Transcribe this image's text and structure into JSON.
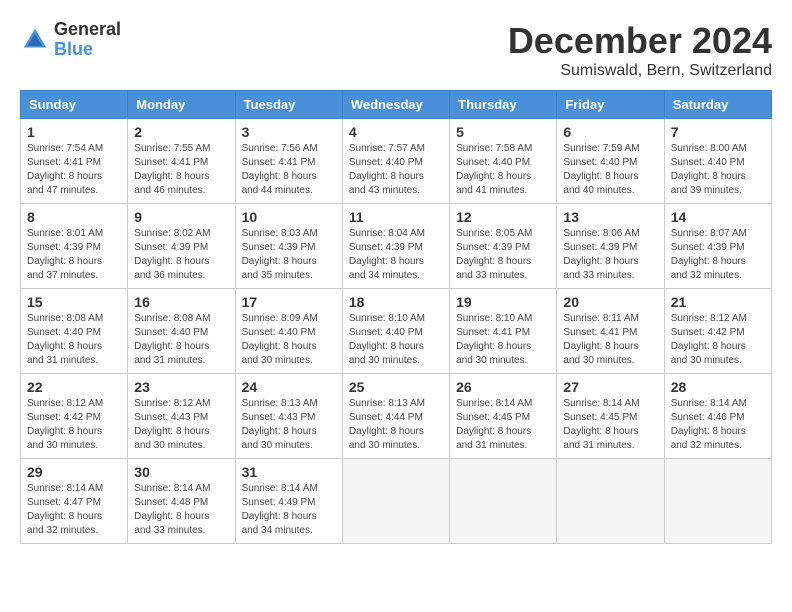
{
  "logo": {
    "general": "General",
    "blue": "Blue"
  },
  "title": "December 2024",
  "location": "Sumiswald, Bern, Switzerland",
  "headers": [
    "Sunday",
    "Monday",
    "Tuesday",
    "Wednesday",
    "Thursday",
    "Friday",
    "Saturday"
  ],
  "weeks": [
    [
      {
        "day": "1",
        "sunrise": "7:54 AM",
        "sunset": "4:41 PM",
        "daylight": "8 hours and 47 minutes."
      },
      {
        "day": "2",
        "sunrise": "7:55 AM",
        "sunset": "4:41 PM",
        "daylight": "8 hours and 46 minutes."
      },
      {
        "day": "3",
        "sunrise": "7:56 AM",
        "sunset": "4:41 PM",
        "daylight": "8 hours and 44 minutes."
      },
      {
        "day": "4",
        "sunrise": "7:57 AM",
        "sunset": "4:40 PM",
        "daylight": "8 hours and 43 minutes."
      },
      {
        "day": "5",
        "sunrise": "7:58 AM",
        "sunset": "4:40 PM",
        "daylight": "8 hours and 41 minutes."
      },
      {
        "day": "6",
        "sunrise": "7:59 AM",
        "sunset": "4:40 PM",
        "daylight": "8 hours and 40 minutes."
      },
      {
        "day": "7",
        "sunrise": "8:00 AM",
        "sunset": "4:40 PM",
        "daylight": "8 hours and 39 minutes."
      }
    ],
    [
      {
        "day": "8",
        "sunrise": "8:01 AM",
        "sunset": "4:39 PM",
        "daylight": "8 hours and 37 minutes."
      },
      {
        "day": "9",
        "sunrise": "8:02 AM",
        "sunset": "4:39 PM",
        "daylight": "8 hours and 36 minutes."
      },
      {
        "day": "10",
        "sunrise": "8:03 AM",
        "sunset": "4:39 PM",
        "daylight": "8 hours and 35 minutes."
      },
      {
        "day": "11",
        "sunrise": "8:04 AM",
        "sunset": "4:39 PM",
        "daylight": "8 hours and 34 minutes."
      },
      {
        "day": "12",
        "sunrise": "8:05 AM",
        "sunset": "4:39 PM",
        "daylight": "8 hours and 33 minutes."
      },
      {
        "day": "13",
        "sunrise": "8:06 AM",
        "sunset": "4:39 PM",
        "daylight": "8 hours and 33 minutes."
      },
      {
        "day": "14",
        "sunrise": "8:07 AM",
        "sunset": "4:39 PM",
        "daylight": "8 hours and 32 minutes."
      }
    ],
    [
      {
        "day": "15",
        "sunrise": "8:08 AM",
        "sunset": "4:40 PM",
        "daylight": "8 hours and 31 minutes."
      },
      {
        "day": "16",
        "sunrise": "8:08 AM",
        "sunset": "4:40 PM",
        "daylight": "8 hours and 31 minutes."
      },
      {
        "day": "17",
        "sunrise": "8:09 AM",
        "sunset": "4:40 PM",
        "daylight": "8 hours and 30 minutes."
      },
      {
        "day": "18",
        "sunrise": "8:10 AM",
        "sunset": "4:40 PM",
        "daylight": "8 hours and 30 minutes."
      },
      {
        "day": "19",
        "sunrise": "8:10 AM",
        "sunset": "4:41 PM",
        "daylight": "8 hours and 30 minutes."
      },
      {
        "day": "20",
        "sunrise": "8:11 AM",
        "sunset": "4:41 PM",
        "daylight": "8 hours and 30 minutes."
      },
      {
        "day": "21",
        "sunrise": "8:12 AM",
        "sunset": "4:42 PM",
        "daylight": "8 hours and 30 minutes."
      }
    ],
    [
      {
        "day": "22",
        "sunrise": "8:12 AM",
        "sunset": "4:42 PM",
        "daylight": "8 hours and 30 minutes."
      },
      {
        "day": "23",
        "sunrise": "8:12 AM",
        "sunset": "4:43 PM",
        "daylight": "8 hours and 30 minutes."
      },
      {
        "day": "24",
        "sunrise": "8:13 AM",
        "sunset": "4:43 PM",
        "daylight": "8 hours and 30 minutes."
      },
      {
        "day": "25",
        "sunrise": "8:13 AM",
        "sunset": "4:44 PM",
        "daylight": "8 hours and 30 minutes."
      },
      {
        "day": "26",
        "sunrise": "8:14 AM",
        "sunset": "4:45 PM",
        "daylight": "8 hours and 31 minutes."
      },
      {
        "day": "27",
        "sunrise": "8:14 AM",
        "sunset": "4:45 PM",
        "daylight": "8 hours and 31 minutes."
      },
      {
        "day": "28",
        "sunrise": "8:14 AM",
        "sunset": "4:46 PM",
        "daylight": "8 hours and 32 minutes."
      }
    ],
    [
      {
        "day": "29",
        "sunrise": "8:14 AM",
        "sunset": "4:47 PM",
        "daylight": "8 hours and 32 minutes."
      },
      {
        "day": "30",
        "sunrise": "8:14 AM",
        "sunset": "4:48 PM",
        "daylight": "8 hours and 33 minutes."
      },
      {
        "day": "31",
        "sunrise": "8:14 AM",
        "sunset": "4:49 PM",
        "daylight": "8 hours and 34 minutes."
      },
      null,
      null,
      null,
      null
    ]
  ]
}
